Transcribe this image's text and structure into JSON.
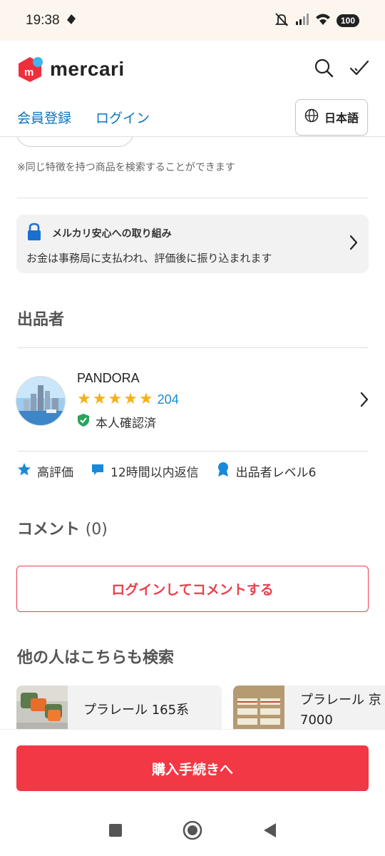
{
  "status_bar": {
    "time": "19:38",
    "battery": "100"
  },
  "header": {
    "logo_text": "mercari",
    "icons": [
      "search-icon",
      "check-icon"
    ]
  },
  "auth": {
    "register": "会員登録",
    "login": "ログイン",
    "language": "日本語"
  },
  "content": {
    "note": "※同じ特徴を持つ商品を検索することができます",
    "safety": {
      "title": "メルカリ安心への取り組み",
      "description": "お金は事務局に支払われ、評価後に振り込まれます"
    },
    "seller_section_title": "出品者",
    "seller": {
      "name": "PANDORA",
      "rating_stars": 5,
      "rating_count": "204",
      "verified": "本人確認済"
    },
    "badges": {
      "high_rating": "高評価",
      "reply": "12時間以内返信",
      "level": "出品者レベル6"
    },
    "comment_section": {
      "title": "コメント",
      "count": "(0)",
      "button": "ログインしてコメントする"
    },
    "related_search": {
      "title": "他の人はこちらも検索",
      "items": [
        {
          "label": "プラレール 165系"
        },
        {
          "label": "プラレール 京\n7000"
        }
      ]
    }
  },
  "bottom": {
    "purchase_button": "購入手続きへ"
  },
  "colors": {
    "brand_red": "#f23845",
    "link_blue": "#0a75c2",
    "star_yellow": "#f6b01e"
  }
}
